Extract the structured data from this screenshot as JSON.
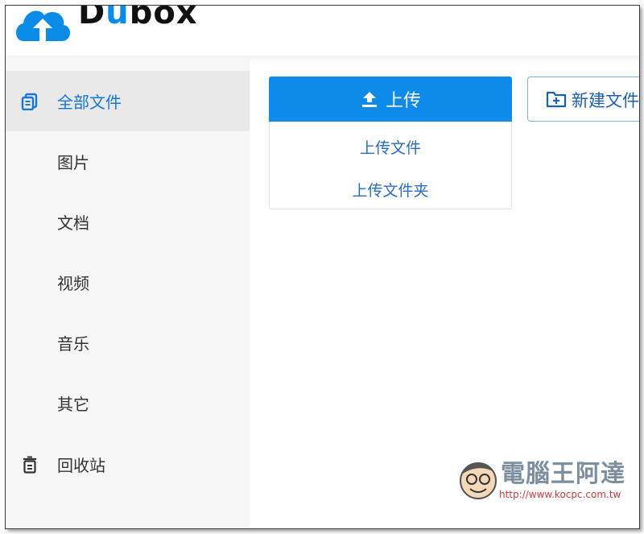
{
  "app": {
    "logo_text_prefix": "D",
    "logo_text_accent": "u",
    "logo_text_suffix": "box"
  },
  "sidebar": {
    "items": [
      {
        "label": "全部文件",
        "icon": "files-icon",
        "active": true
      },
      {
        "label": "图片",
        "icon": null,
        "active": false
      },
      {
        "label": "文档",
        "icon": null,
        "active": false
      },
      {
        "label": "视频",
        "icon": null,
        "active": false
      },
      {
        "label": "音乐",
        "icon": null,
        "active": false
      },
      {
        "label": "其它",
        "icon": null,
        "active": false
      },
      {
        "label": "回收站",
        "icon": "trash-icon",
        "active": false
      }
    ]
  },
  "toolbar": {
    "upload_label": "上传",
    "upload_menu": [
      "上传文件",
      "上传文件夹"
    ],
    "new_folder_label": "新建文件"
  },
  "watermark": {
    "title": "電腦王阿達",
    "url": "http://www.kocpc.com.tw"
  },
  "colors": {
    "accent": "#0e8bea",
    "active_text": "#1677d9",
    "sidebar_bg": "#f6f6f6",
    "active_bg": "#e9e9e9"
  }
}
